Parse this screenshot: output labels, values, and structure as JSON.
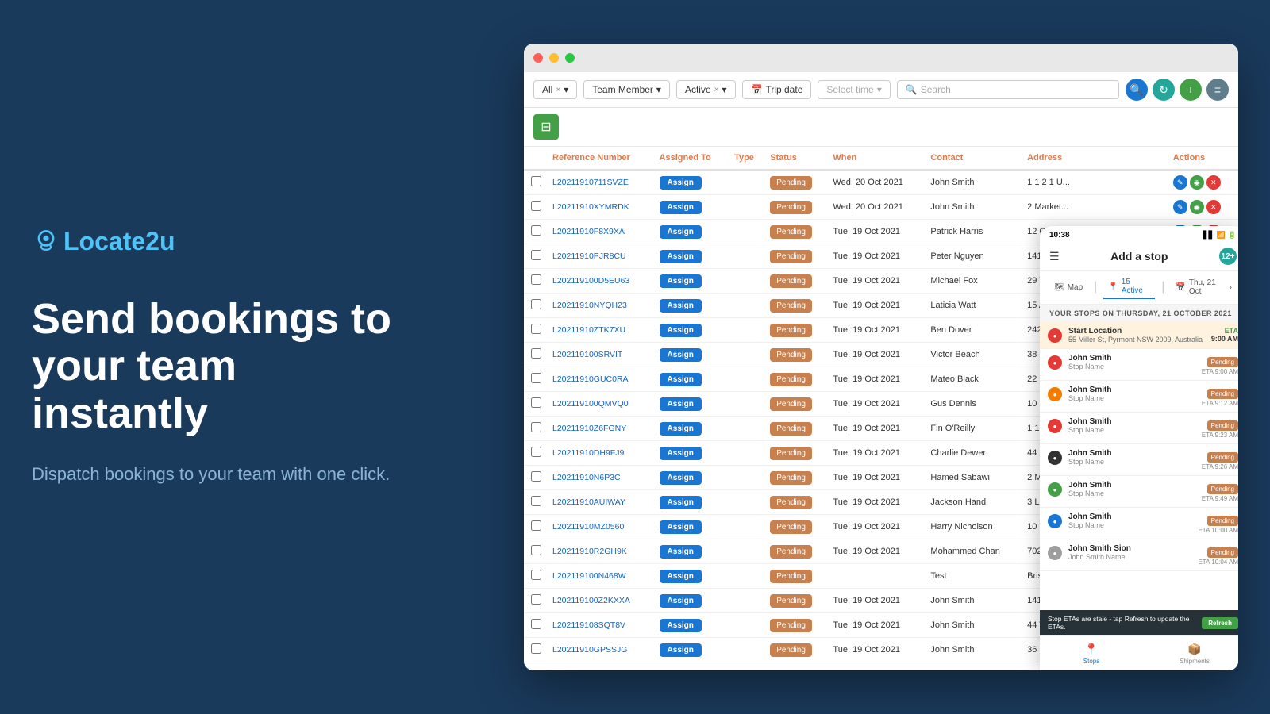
{
  "app": {
    "title": "Locate2u",
    "logo_text_locate": "Locate",
    "logo_text_2u": "2u"
  },
  "hero": {
    "headline": "Send bookings to your team instantly",
    "subtext": "Dispatch bookings to your team with one click."
  },
  "browser": {
    "toolbar": {
      "filter_all": "All",
      "filter_all_x": "×",
      "filter_team_member": "Team Member",
      "filter_active": "Active",
      "filter_active_x": "×",
      "filter_trip_date": "Trip date",
      "filter_select_time": "Select time",
      "filter_search": "Search"
    },
    "table": {
      "headers": [
        "",
        "Reference Number",
        "Assigned To",
        "Type",
        "Status",
        "When",
        "Contact",
        "Address",
        "Actions"
      ],
      "rows": [
        {
          "ref": "L20211910711SVZE",
          "assigned": "Assign",
          "type": "",
          "status": "Pending",
          "when": "Wed, 20 Oct 2021",
          "contact": "John Smith",
          "address": "1 1 2 1 U..."
        },
        {
          "ref": "L20211910XYMRDK",
          "assigned": "Assign",
          "type": "",
          "status": "Pending",
          "when": "Wed, 20 Oct 2021",
          "contact": "John Smith",
          "address": "2 Market..."
        },
        {
          "ref": "L20211910F8X9XA",
          "assigned": "Assign",
          "type": "",
          "status": "Pending",
          "when": "Tue, 19 Oct 2021",
          "contact": "Patrick Harris",
          "address": "12 O'Con..."
        },
        {
          "ref": "L20211910PJR8CU",
          "assigned": "Assign",
          "type": "",
          "status": "Pending",
          "when": "Tue, 19 Oct 2021",
          "contact": "Peter Nguyen",
          "address": "141 Walk..."
        },
        {
          "ref": "L202119100D5EU63",
          "assigned": "Assign",
          "type": "",
          "status": "Pending",
          "when": "Tue, 19 Oct 2021",
          "contact": "Michael Fox",
          "address": "29 Wakef..."
        },
        {
          "ref": "L20211910NYQH23",
          "assigned": "Assign",
          "type": "",
          "status": "Pending",
          "when": "Tue, 19 Oct 2021",
          "contact": "Laticia Watt",
          "address": "15 Albert..."
        },
        {
          "ref": "L20211910ZTK7XU",
          "assigned": "Assign",
          "type": "",
          "status": "Pending",
          "when": "Tue, 19 Oct 2021",
          "contact": "Ben Dover",
          "address": "242 Arden..."
        },
        {
          "ref": "L202119100SRVIT",
          "assigned": "Assign",
          "type": "",
          "status": "Pending",
          "when": "Tue, 19 Oct 2021",
          "contact": "Victor Beach",
          "address": "38 Queen..."
        },
        {
          "ref": "L20211910GUC0RA",
          "assigned": "Assign",
          "type": "",
          "status": "Pending",
          "when": "Tue, 19 Oct 2021",
          "contact": "Mateo Black",
          "address": "22 Brook..."
        },
        {
          "ref": "L202119100QMVQ0",
          "assigned": "Assign",
          "type": "",
          "status": "Pending",
          "when": "Tue, 19 Oct 2021",
          "contact": "Gus Dennis",
          "address": "10 Eliza..."
        },
        {
          "ref": "L20211910Z6FGNY",
          "assigned": "Assign",
          "type": "",
          "status": "Pending",
          "when": "Tue, 19 Oct 2021",
          "contact": "Fin O'Reilly",
          "address": "1 1 2 1 U..."
        },
        {
          "ref": "L20211910DH9FJ9",
          "assigned": "Assign",
          "type": "",
          "status": "Pending",
          "when": "Tue, 19 Oct 2021",
          "contact": "Charlie Dewer",
          "address": "44 Mark..."
        },
        {
          "ref": "L20211910N6P3C",
          "assigned": "Assign",
          "type": "",
          "status": "Pending",
          "when": "Tue, 19 Oct 2021",
          "contact": "Hamed Sabawi",
          "address": "2 Market..."
        },
        {
          "ref": "L20211910AUIWAY",
          "assigned": "Assign",
          "type": "",
          "status": "Pending",
          "when": "Tue, 19 Oct 2021",
          "contact": "Jackson Hand",
          "address": "3 Linden..."
        },
        {
          "ref": "L20211910MZ0560",
          "assigned": "Assign",
          "type": "",
          "status": "Pending",
          "when": "Tue, 19 Oct 2021",
          "contact": "Harry Nicholson",
          "address": "10 10 Eliz..."
        },
        {
          "ref": "L20211910R2GH9K",
          "assigned": "Assign",
          "type": "",
          "status": "Pending",
          "when": "Tue, 19 Oct 2021",
          "contact": "Mohammed Chan",
          "address": "702-730 R..."
        },
        {
          "ref": "L202119100N468W",
          "assigned": "Assign",
          "type": "",
          "status": "Pending",
          "when": "",
          "contact": "Test",
          "address": "Brisbane C..."
        },
        {
          "ref": "L202119100Z2KXXA",
          "assigned": "Assign",
          "type": "",
          "status": "Pending",
          "when": "Tue, 19 Oct 2021",
          "contact": "John Smith",
          "address": "141 Walker Street, North Sydney, New South W..."
        },
        {
          "ref": "L202119108SQT8V",
          "assigned": "Assign",
          "type": "",
          "status": "Pending",
          "when": "Tue, 19 Oct 2021",
          "contact": "John Smith",
          "address": "44 Wharf Road, Melrose Park, New South Wale..."
        },
        {
          "ref": "L20211910GPSSJG",
          "assigned": "Assign",
          "type": "",
          "status": "Pending",
          "when": "Tue, 19 Oct 2021",
          "contact": "John Smith",
          "address": "36 Surrey Street, Darlinghurst, New South Wale..."
        }
      ]
    }
  },
  "phone": {
    "time": "10:38",
    "header": {
      "add_stop": "Add a stop",
      "stop_count": "12+"
    },
    "tabs": {
      "map": "Map",
      "active_count": "15 Active",
      "date": "Thu, 21 Oct"
    },
    "stops_header": "YOUR STOPS ON THURSDAY, 21 OCTOBER 2021",
    "start_location": {
      "label": "Start Location",
      "address": "55 Miller St, Pyrmont NSW 2009, Australia",
      "eta_label": "ETA",
      "eta_time": "9:00 AM"
    },
    "stops": [
      {
        "name": "John Smith",
        "sub": "Stop Name",
        "eta": "ETA  9:00 AM",
        "status": "Pending",
        "dot": "red"
      },
      {
        "name": "John Smith",
        "sub": "Stop Name",
        "eta": "ETA  9:12 AM",
        "status": "Pending",
        "dot": "orange"
      },
      {
        "name": "John Smith",
        "sub": "Stop Name",
        "eta": "ETA  9:23 AM",
        "status": "Pending",
        "dot": "red"
      },
      {
        "name": "John Smith",
        "sub": "Stop Name",
        "eta": "ETA  9:26 AM",
        "status": "Pending",
        "dot": "dark"
      },
      {
        "name": "John Smith",
        "sub": "Stop Name",
        "eta": "ETA  9:49 AM",
        "status": "Pending",
        "dot": "green"
      },
      {
        "name": "John Smith",
        "sub": "Stop Name",
        "eta": "ETA  10:00 AM",
        "status": "Pending",
        "dot": "blue"
      },
      {
        "name": "John Smith Sion",
        "sub": "John Smith Name",
        "eta": "ETA  10:04 AM",
        "status": "Pending",
        "dot": "gray"
      }
    ],
    "refresh_banner": {
      "message": "Stop ETAs are stale - tap Refresh to update the ETAs.",
      "button": "Refresh"
    },
    "bottom_nav": {
      "stops": "Stops",
      "shipments": "Shipments"
    }
  }
}
